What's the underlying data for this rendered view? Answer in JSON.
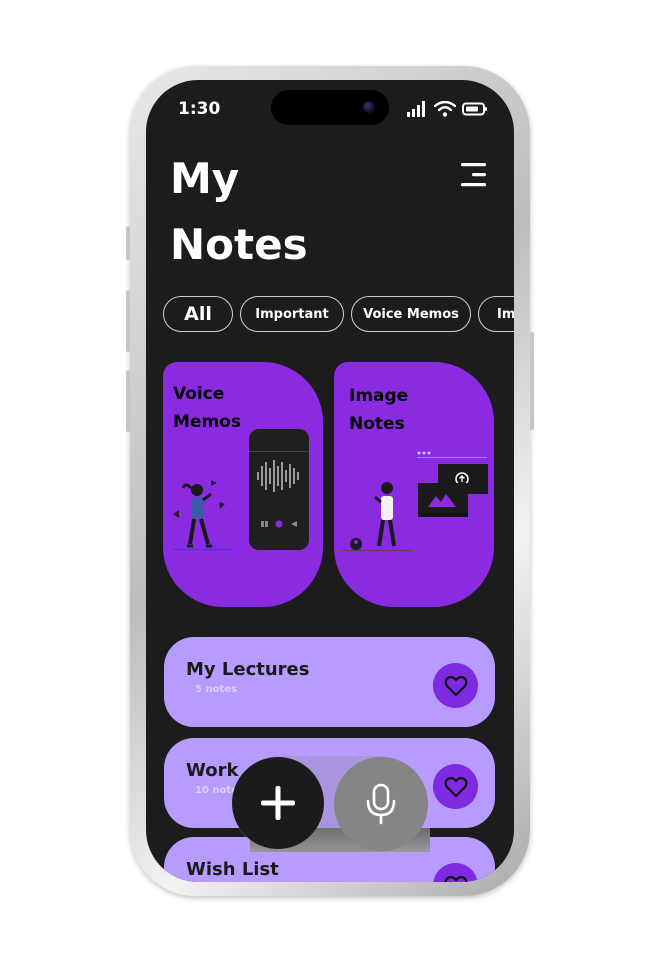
{
  "status_bar": {
    "time": "1:30"
  },
  "header": {
    "title_line1": "My",
    "title_line2": "Notes"
  },
  "filters": [
    "All",
    "Important",
    "Voice Memos",
    "Ima"
  ],
  "feature_cards": [
    {
      "title_line1": "Voice",
      "title_line2": "Memos"
    },
    {
      "title_line1": "Image",
      "title_line2": "Notes"
    }
  ],
  "note_lists": [
    {
      "title": "My Lectures",
      "count": "5 notes"
    },
    {
      "title": "Work",
      "count": "10 notes"
    },
    {
      "title": "Wish List",
      "count": ""
    }
  ],
  "colors": {
    "background": "#1c1c1c",
    "accent_purple": "#8a2be2",
    "list_card": "#b89bff",
    "heart_button": "#7d2ae0"
  },
  "icons": {
    "menu": "hamburger-menu-icon",
    "heart": "heart-icon",
    "add": "plus-icon",
    "mic": "microphone-icon"
  }
}
